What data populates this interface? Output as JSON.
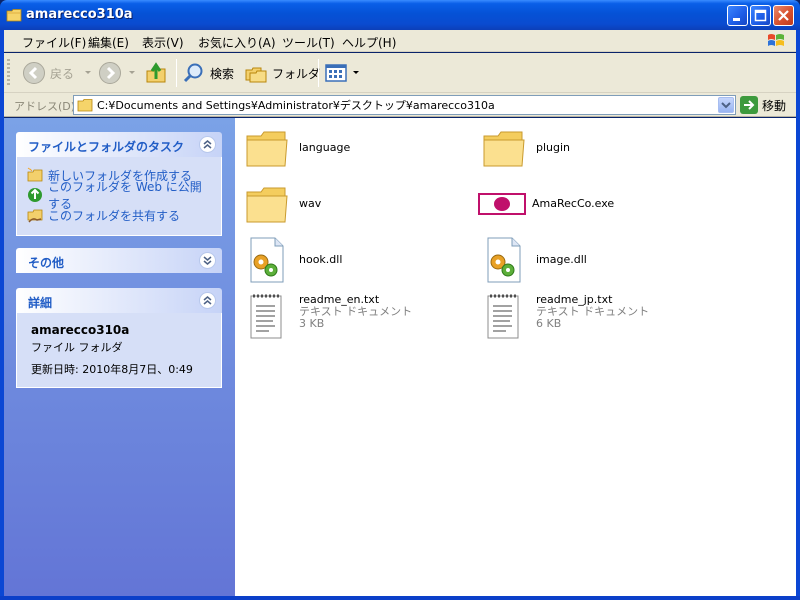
{
  "window": {
    "title": "amarecco310a"
  },
  "menu": {
    "items": [
      "ファイル(F)",
      "編集(E)",
      "表示(V)",
      "お気に入り(A)",
      "ツール(T)",
      "ヘルプ(H)"
    ]
  },
  "toolbar": {
    "back_label": "戻る",
    "search_label": "検索",
    "folders_label": "フォルダ"
  },
  "address": {
    "label": "アドレス(D)",
    "path": "C:¥Documents and Settings¥Administrator¥デスクトップ¥amarecco310a",
    "go_label": "移動"
  },
  "taskpane": {
    "file_tasks": {
      "title": "ファイルとフォルダのタスク",
      "items": [
        "新しいフォルダを作成する",
        "このフォルダを Web に公開する",
        "このフォルダを共有する"
      ]
    },
    "other": {
      "title": "その他"
    },
    "details": {
      "title": "詳細",
      "name": "amarecco310a",
      "type": "ファイル フォルダ",
      "modified": "更新日時: 2010年8月7日、0:49"
    }
  },
  "files": [
    {
      "name": "language",
      "kind": "folder-icon"
    },
    {
      "name": "plugin",
      "kind": "folder-icon"
    },
    {
      "name": "wav",
      "kind": "folder-icon"
    },
    {
      "name": "AmaRecCo.exe",
      "kind": "exe-icon"
    },
    {
      "name": "hook.dll",
      "kind": "dll-icon"
    },
    {
      "name": "image.dll",
      "kind": "dll-icon"
    },
    {
      "name": "readme_en.txt",
      "kind": "text-file-icon",
      "type": "テキスト ドキュメント",
      "size": "3 KB"
    },
    {
      "name": "readme_jp.txt",
      "kind": "text-file-icon",
      "type": "テキスト ドキュメント",
      "size": "6 KB"
    }
  ],
  "colors": {
    "titlebar": "#0552D6",
    "taskpane_top": "#7BA2E7",
    "taskpane_bottom": "#6375D6",
    "link": "#215DC6",
    "folder": "#F7D774",
    "exe_dot": "#C0106B"
  }
}
